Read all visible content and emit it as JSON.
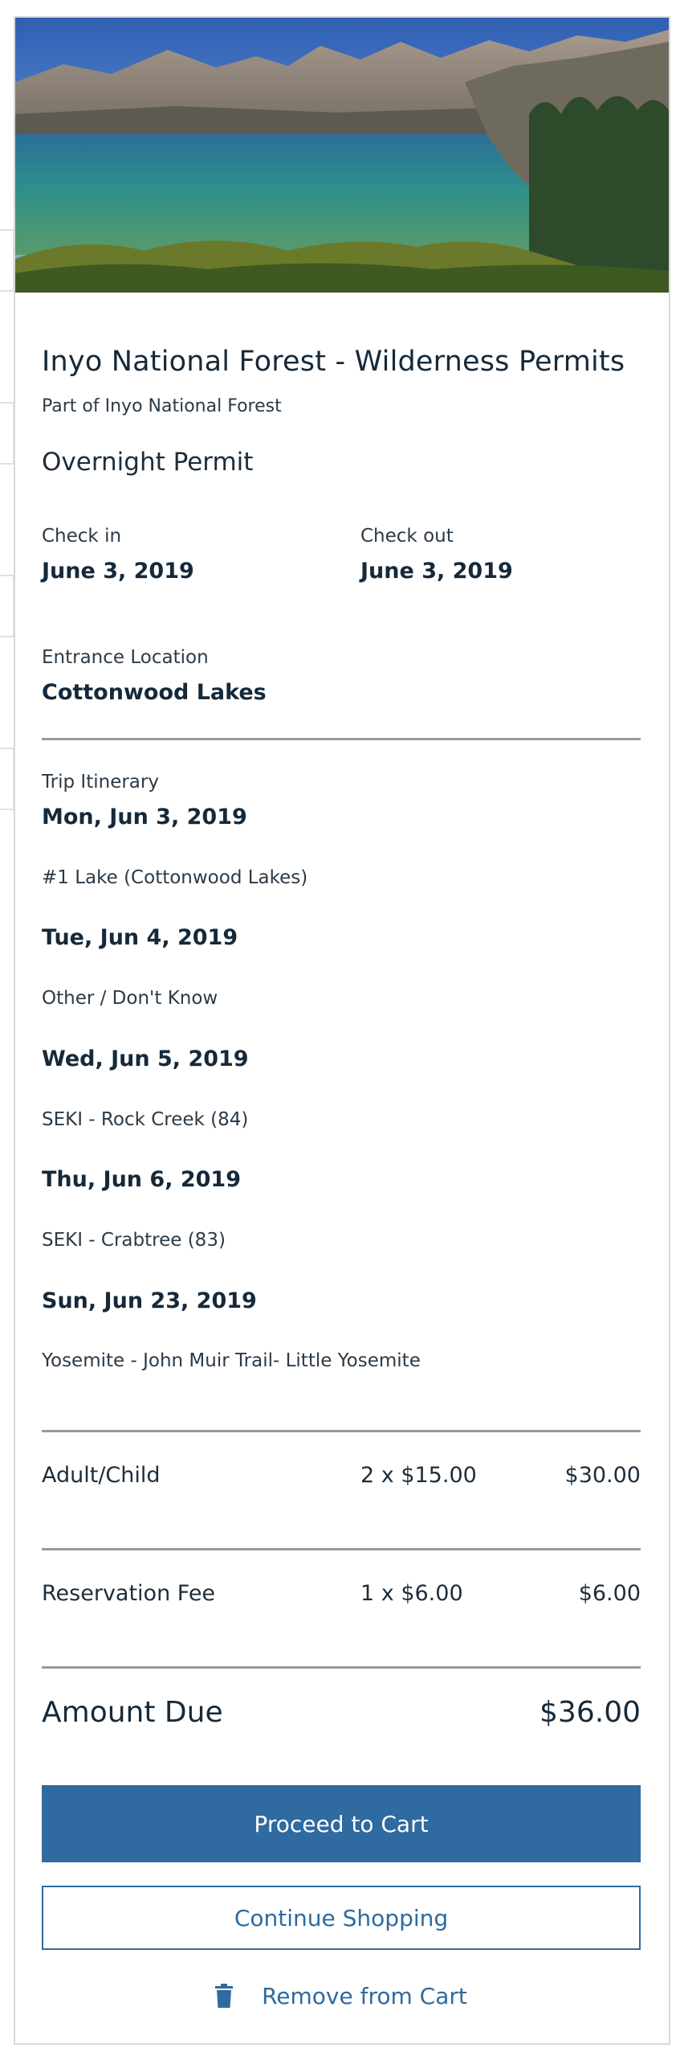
{
  "permit": {
    "title": "Inyo National Forest - Wilderness Permits",
    "subtitle": "Part of Inyo National Forest",
    "type": "Overnight Permit",
    "check_in_label": "Check in",
    "check_in_value": "June 3, 2019",
    "check_out_label": "Check out",
    "check_out_value": "June 3, 2019",
    "entrance_label": "Entrance Location",
    "entrance_value": "Cottonwood Lakes"
  },
  "itinerary": {
    "label": "Trip Itinerary",
    "days": [
      {
        "date": "Mon, Jun 3, 2019",
        "location": "#1 Lake (Cottonwood Lakes)"
      },
      {
        "date": "Tue, Jun 4, 2019",
        "location": "Other / Don't Know"
      },
      {
        "date": "Wed, Jun 5, 2019",
        "location": "SEKI - Rock Creek (84)"
      },
      {
        "date": "Thu, Jun 6, 2019",
        "location": "SEKI - Crabtree (83)"
      },
      {
        "date": "Sun, Jun 23, 2019",
        "location": "Yosemite - John Muir Trail- Little Yosemite"
      }
    ]
  },
  "fees": [
    {
      "name": "Adult/Child",
      "qty": "2 x $15.00",
      "total": "$30.00"
    },
    {
      "name": "Reservation Fee",
      "qty": "1 x $6.00",
      "total": "$6.00"
    }
  ],
  "amount_due": {
    "label": "Amount Due",
    "value": "$36.00"
  },
  "actions": {
    "proceed_label": "Proceed to Cart",
    "continue_label": "Continue Shopping",
    "remove_label": "Remove from Cart"
  },
  "icons": {
    "remove": "trash-icon"
  },
  "colors": {
    "primary": "#2f6aa0",
    "text": "#15293a",
    "divider": "#9a9a9a"
  }
}
